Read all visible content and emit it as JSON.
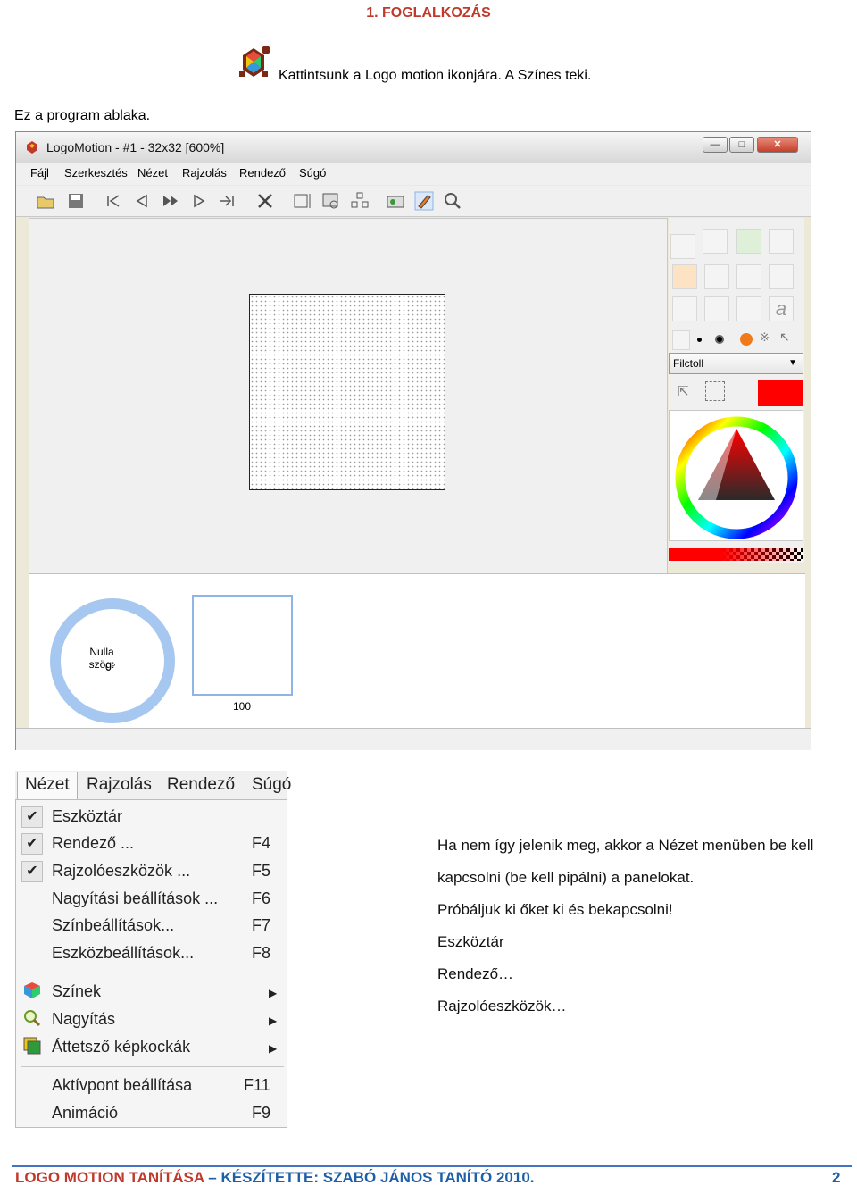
{
  "heading": "1.   FOGLALKOZÁS",
  "intro": "Kattintsunk a Logo motion ikonjára. A Színes teki.",
  "caption": "Ez a program ablaka.",
  "window": {
    "title": "LogoMotion - #1 - 32x32 [600%]",
    "menus": [
      "Fájl",
      "Szerkesztés",
      "Nézet",
      "Rajzolás",
      "Rendező",
      "Súgó"
    ],
    "tool_combo": "Filctoll",
    "brush_color": "#ff0000",
    "ring_label": "Nulla szög:",
    "ring_value": "0°",
    "frame_number": "100"
  },
  "view_menu": {
    "bar": [
      "Nézet",
      "Rajzolás",
      "Rendező",
      "Súgó"
    ],
    "items": [
      {
        "label": "Eszköztár",
        "key": "",
        "checked": true
      },
      {
        "label": "Rendező ...",
        "key": "F4",
        "checked": true
      },
      {
        "label": "Rajzolóeszközök ...",
        "key": "F5",
        "checked": true
      },
      {
        "label": "Nagyítási beállítások ...",
        "key": "F6",
        "checked": false
      },
      {
        "label": "Színbeállítások...",
        "key": "F7",
        "checked": false
      },
      {
        "label": "Eszközbeállítások...",
        "key": "F8",
        "checked": false
      }
    ],
    "submenus": [
      {
        "label": "Színek",
        "icon": "color-cube-icon"
      },
      {
        "label": "Nagyítás",
        "icon": "magnifier-icon"
      },
      {
        "label": "Áttetsző képkockák",
        "icon": "frames-icon"
      }
    ],
    "extra": [
      {
        "label": "Aktívpont beállítása",
        "key": "F11"
      },
      {
        "label": "Animáció",
        "key": "F9"
      }
    ]
  },
  "instructions": [
    "Ha nem így jelenik meg, akkor a Nézet menüben be kell",
    "kapcsolni (be kell pipálni) a panelokat.",
    "Próbáljuk ki őket ki és bekapcsolni!",
    "Eszköztár",
    "Rendező…",
    "Rajzolóeszközök…"
  ],
  "footer": {
    "part1": "LOGO MOTION TANÍTÁSA",
    "dash": " – ",
    "part2": "KÉSZÍTETTE: SZABÓ JÁNOS TANÍTÓ 2010.",
    "page": "2"
  }
}
